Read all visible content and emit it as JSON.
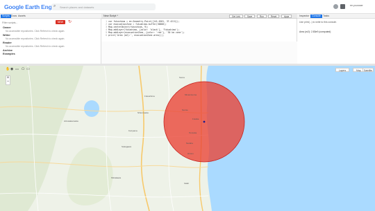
{
  "app": {
    "logo_text": "Google Earth Engine",
    "search_placeholder": "Search places and datasets",
    "user_label": "ee-youruser"
  },
  "left_panel": {
    "tabs": [
      "Scripts",
      "Docs",
      "Assets"
    ],
    "active_tab": "Scripts",
    "filter_placeholder": "Filter scripts...",
    "new_button": "NEW",
    "tree": [
      {
        "label": "Owner",
        "note": "No accessible repositories. Click Refresh to check again."
      },
      {
        "label": "Writer",
        "note": "No accessible repositories. Click Refresh to check again."
      },
      {
        "label": "Reader",
        "note": "No accessible repositories. Click Refresh to check again."
      },
      {
        "label": "Archive",
        "note": ""
      },
      {
        "label": "Examples",
        "note": ""
      }
    ]
  },
  "editor": {
    "script_name": "New Script *",
    "buttons": [
      "Get Link",
      "Save",
      "Run",
      "Reset",
      "Apps"
    ],
    "code_lines": [
      {
        "n": "1",
        "text": "var fukushima = ee.Geometry.Point([141.0281, 37.4211]);"
      },
      {
        "n": "2",
        "text": "var evacuationZone = fukushima.buffer(30000);"
      },
      {
        "n": "3",
        "text": "Map.centerObject(fukushima, 9);"
      },
      {
        "n": "4",
        "text": "Map.addLayer(fukushima, {color: 'black'}, 'Fukushima');"
      },
      {
        "n": "5",
        "text": "Map.addLayer(evacuationZone, {color: 'red'}, '30 km zone');"
      },
      {
        "n": "6",
        "text": "print('Area (m2):', evacuationZone.area());"
      }
    ]
  },
  "right_panel": {
    "tabs": [
      "Inspector",
      "Console",
      "Tasks"
    ],
    "active_tab": "Console",
    "hint": "Use print(...) to write to this console.",
    "output": "Area (m2): 2.83e9 (computed)"
  },
  "map": {
    "tools": [
      "hand-icon",
      "point-icon",
      "line-icon",
      "polygon-icon",
      "rectangle-icon"
    ],
    "layers_button": "Layers",
    "map_type_button": "Map",
    "satellite_button": "Satellite",
    "zoom_in": "+",
    "zoom_out": "−",
    "places": [
      "Fukushima",
      "Koriyama",
      "Iwaki",
      "Soma",
      "Minamisoma",
      "Namie",
      "Futaba",
      "Tomioka",
      "Naraha",
      "Hirono",
      "Aizuwakamatsu",
      "Sukagawa",
      "Shirakawa",
      "Nihonmatsu"
    ],
    "zone_color": "#ea4335"
  }
}
